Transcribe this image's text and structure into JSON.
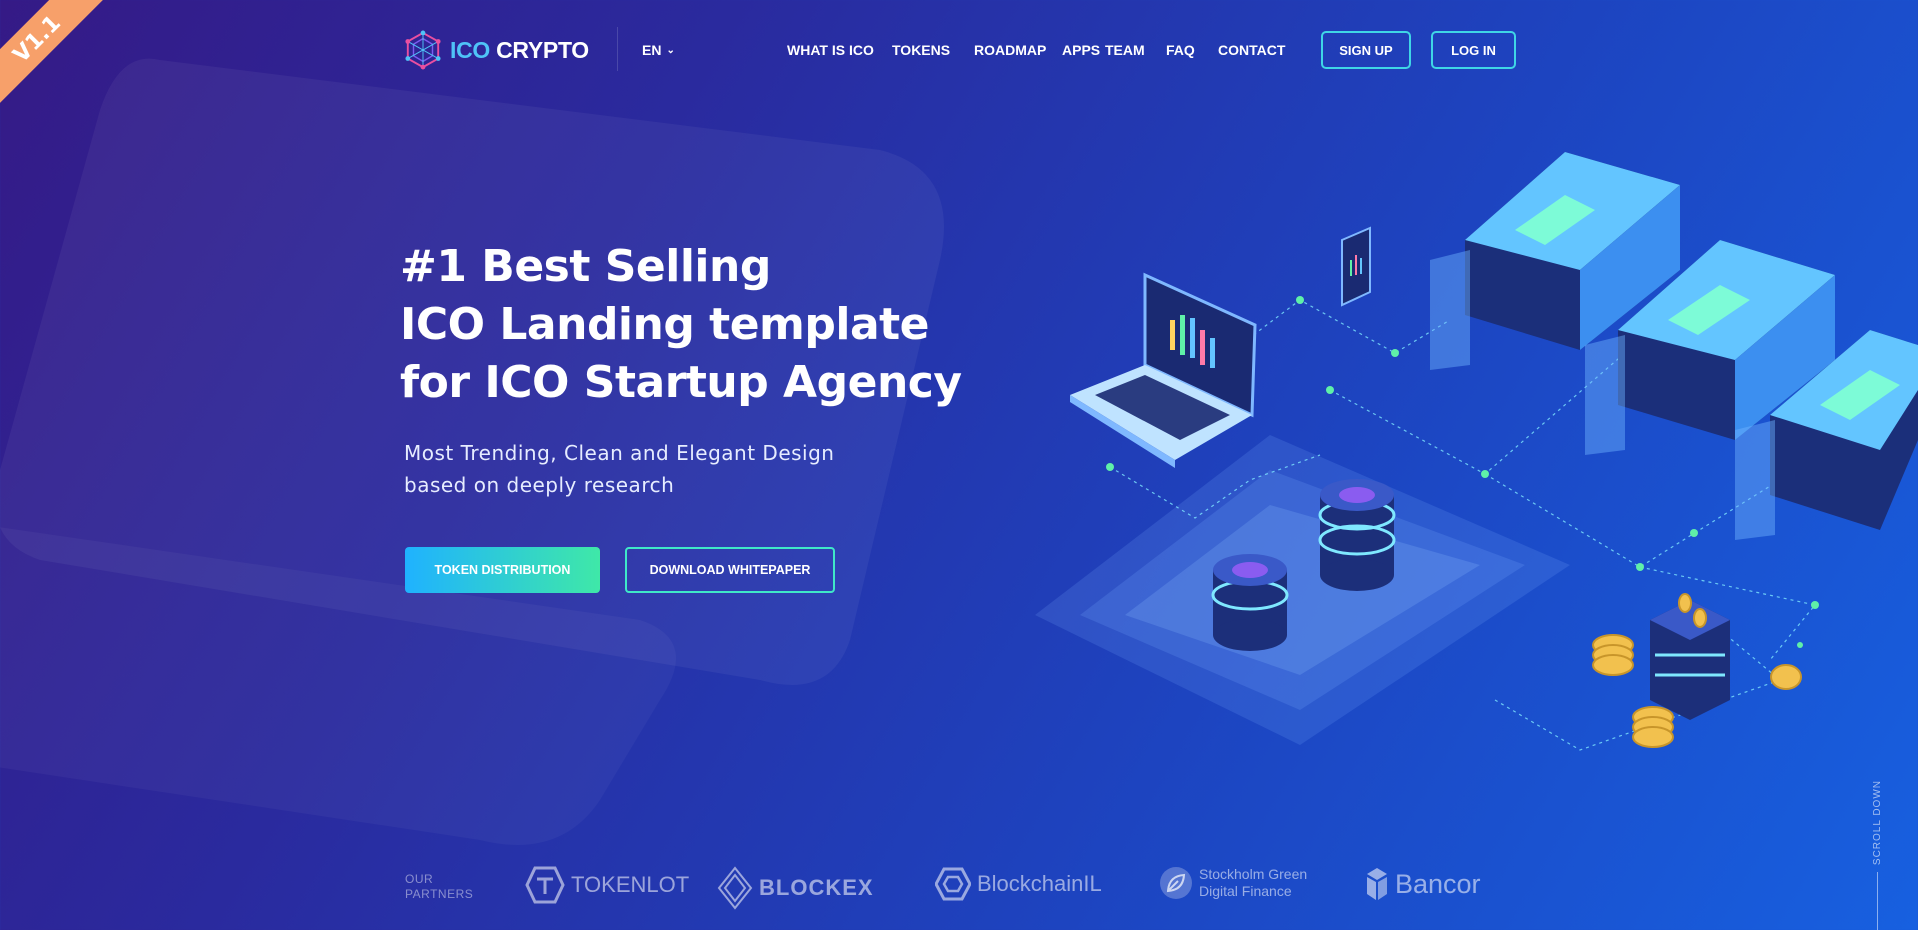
{
  "version_badge": "V1.1",
  "brand": {
    "part1": "ICO",
    "part2": "CRYPTO"
  },
  "lang": {
    "label": "EN"
  },
  "nav": {
    "items": [
      "WHAT IS ICO",
      "TOKENS",
      "ROADMAP",
      "APPS",
      "TEAM",
      "FAQ",
      "CONTACT"
    ],
    "signup": "SIGN UP",
    "login": "LOG IN"
  },
  "hero": {
    "title_lines": [
      "#1 Best Selling",
      "ICO Landing template",
      "for ICO Startup Agency"
    ],
    "subtitle_lines": [
      "Most Trending, Clean and Elegant Design",
      "based on deeply research"
    ],
    "cta_primary": "TOKEN DISTRIBUTION",
    "cta_secondary": "DOWNLOAD WHITEPAPER"
  },
  "partners": {
    "label_lines": [
      "OUR",
      "PARTNERS"
    ],
    "items": [
      {
        "name": "TOKENLOT",
        "icon": "tokenlot-logo-icon"
      },
      {
        "name": "BLOCKEX",
        "icon": "blockex-logo-icon"
      },
      {
        "name": "BlockchainIL",
        "icon": "blockchainil-logo-icon"
      },
      {
        "name_lines": [
          "Stockholm Green",
          "Digital Finance"
        ],
        "icon": "stockholm-leaf-icon"
      },
      {
        "name": "Bancor",
        "icon": "bancor-logo-icon"
      }
    ]
  },
  "scroll_label": "SCROLL DOWN",
  "colors": {
    "accent_cyan": "#3fd6e6",
    "accent_green": "#3fe8a8",
    "brand_blue": "#4fc3f7",
    "badge_orange": "#f7a06a"
  }
}
